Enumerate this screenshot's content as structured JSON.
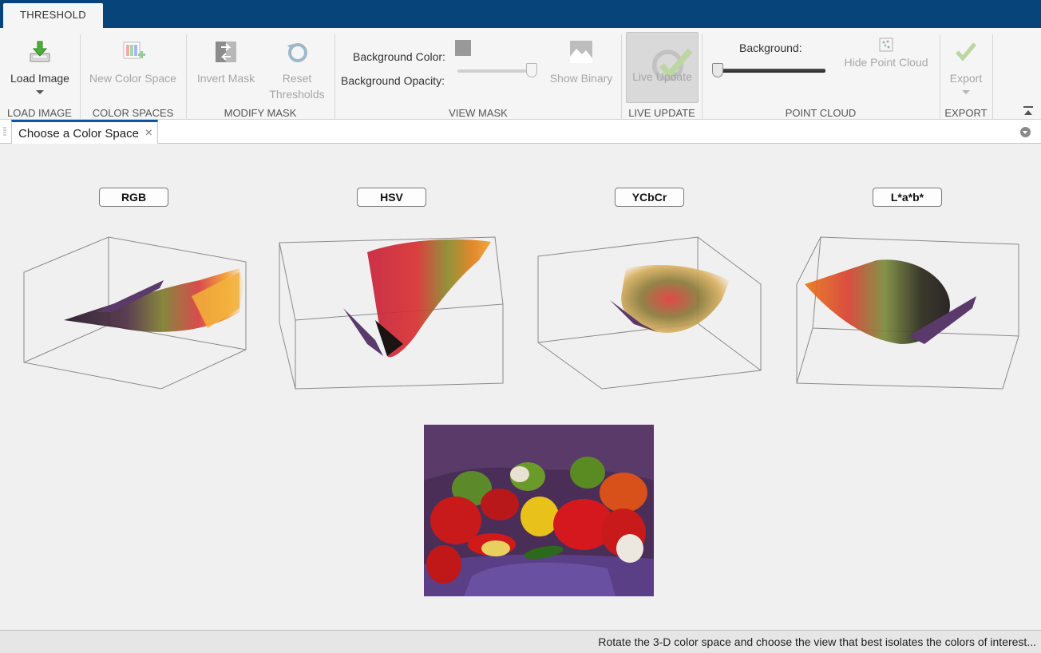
{
  "app_tab": "THRESHOLD",
  "toolstrip": {
    "load_image": {
      "label": "Load Image",
      "section": "LOAD IMAGE"
    },
    "color_spaces": {
      "new_color_space": "New Color Space",
      "section": "COLOR SPACES"
    },
    "modify_mask": {
      "invert_mask": "Invert Mask",
      "reset_line1": "Reset",
      "reset_line2": "Thresholds",
      "section": "MODIFY MASK"
    },
    "view_mask": {
      "background_color_label": "Background Color:",
      "background_opacity_label": "Background Opacity:",
      "background_color_value": "#999999",
      "background_opacity": 1.0,
      "show_binary": "Show Binary",
      "section": "VIEW MASK"
    },
    "live_update": {
      "label": "Live Update",
      "section": "LIVE UPDATE"
    },
    "point_cloud": {
      "background_label": "Background:",
      "background_level": 0.0,
      "hide_point_cloud": "Hide Point Cloud",
      "section": "POINT CLOUD"
    },
    "export": {
      "label": "Export",
      "section": "EXPORT"
    }
  },
  "document_tab": {
    "label": "Choose a Color Space",
    "close_glyph": "×"
  },
  "color_spaces": [
    {
      "label": "RGB"
    },
    {
      "label": "HSV"
    },
    {
      "label": "YCbCr"
    },
    {
      "label": "L*a*b*"
    }
  ],
  "status": {
    "text": "Rotate the 3-D color space and choose the view that best isolates the colors of interest..."
  },
  "colors": {
    "title_bar": "#07447a",
    "accent": "#0a58a5",
    "disabled_text": "#a6a6a6"
  }
}
